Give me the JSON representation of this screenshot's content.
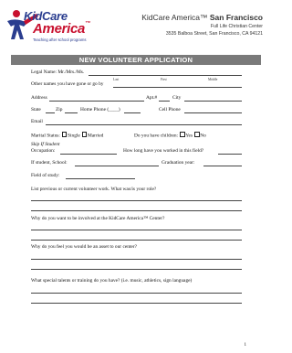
{
  "header": {
    "logo": {
      "word1": "KidCare",
      "word2": "America",
      "tm": "™",
      "tagline": "Teaching after school programs"
    },
    "org_name": "KidCare America™",
    "org_city": "San Francisco",
    "org_center": "Full Life Christian Center",
    "org_address": "3535 Balboa Street, San Francisco, CA 94121"
  },
  "form": {
    "title": "NEW VOLUNTEER APPLICATION",
    "legal_name_label": "Legal Name: Mr./Mrs./Ms.",
    "name_sub_last": "Last",
    "name_sub_first": "First",
    "name_sub_middle": "Middle",
    "other_names_label": "Other names you have gone or go by",
    "address_label": "Address",
    "apt_label": "Apt.#",
    "city_label": "City",
    "state_label": "State",
    "zip_label": "Zip",
    "home_phone_label": "Home Phone (____)",
    "cell_phone_label": "Cell Phone",
    "email_label": "Email",
    "marital_label": "Marital Status:",
    "marital_single": "Single",
    "marital_married": "Married",
    "children_label": "Do you have children:",
    "children_yes": "Yes",
    "children_no": "No",
    "skip_label": "Skip If Student",
    "occupation_label": "Occupation:",
    "how_long_label": "How long have you worked in this field?",
    "if_student_label": "If student, School:",
    "graduation_label": "Graduation year:",
    "field_of_study_label": "Field of study:",
    "q1": "List previous or current volunteer work.  What was/is your role?",
    "q2": "Why do you want to be involved at the KidCare America™ Center?",
    "q3": "Why do you feel you would be an asset to our center?",
    "q4": "What special talents or training do you have? (i.e. music, athletics, sign language)"
  },
  "page_number": "1",
  "colors": {
    "logo_blue": "#2a3d8f",
    "logo_red": "#c8102e",
    "title_bar": "#7a7a7a"
  }
}
